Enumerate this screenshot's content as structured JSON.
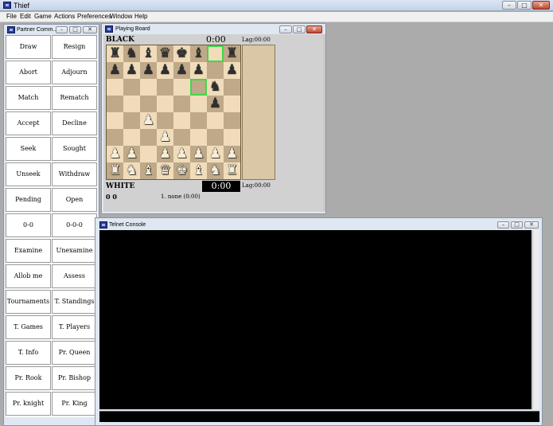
{
  "app": {
    "title": "Thief"
  },
  "menu": [
    "File",
    "Edit",
    "Game",
    "Actions",
    "Preferences",
    "Window",
    "Help"
  ],
  "titlebar_buttons": {
    "minimize": "–",
    "maximize": "□",
    "close": "✕"
  },
  "partner_panel": {
    "title": "Partner Comm...",
    "buttons": [
      [
        "Draw",
        "Resign"
      ],
      [
        "Abort",
        "Adjourn"
      ],
      [
        "Match",
        "Rematch"
      ],
      [
        "Accept",
        "Decline"
      ],
      [
        "Seek",
        "Sought"
      ],
      [
        "Unseek",
        "Withdraw"
      ],
      [
        "Pending",
        "Open"
      ],
      [
        "0-0",
        "0-0-0"
      ],
      [
        "Examine",
        "Unexamine"
      ],
      [
        "Allob me",
        "Assess"
      ],
      [
        "Tournaments",
        "T. Standings"
      ],
      [
        "T. Games",
        "T. Players"
      ],
      [
        "T. Info",
        "Pr. Queen"
      ],
      [
        "Pr. Rook",
        "Pr. Bishop"
      ],
      [
        "Pr. knight",
        "Pr. King"
      ]
    ]
  },
  "board_window": {
    "title": "Playing Board",
    "black_label": "BLACK",
    "white_label": "WHITE",
    "black_clock": "0:00",
    "white_clock": "0:00",
    "lag_top": "Lag:00:00",
    "lag_bottom": "Lag:00:00",
    "score": "0 0",
    "move_text": "1. none (0:00)",
    "ranks": [
      "rnbqkb.r",
      "pppppp.p",
      "......n.",
      "......p.",
      "..P.....",
      "...P....",
      "PP.PPPPP",
      "RNBQKBNR"
    ],
    "highlights": [
      [
        0,
        6
      ],
      [
        2,
        5
      ]
    ]
  },
  "telnet": {
    "title": "Telnet Console",
    "output": "",
    "input": ""
  },
  "icons": {
    "K": "♚",
    "Q": "♛",
    "R": "♜",
    "B": "♝",
    "N": "♞",
    "P": "♟"
  }
}
